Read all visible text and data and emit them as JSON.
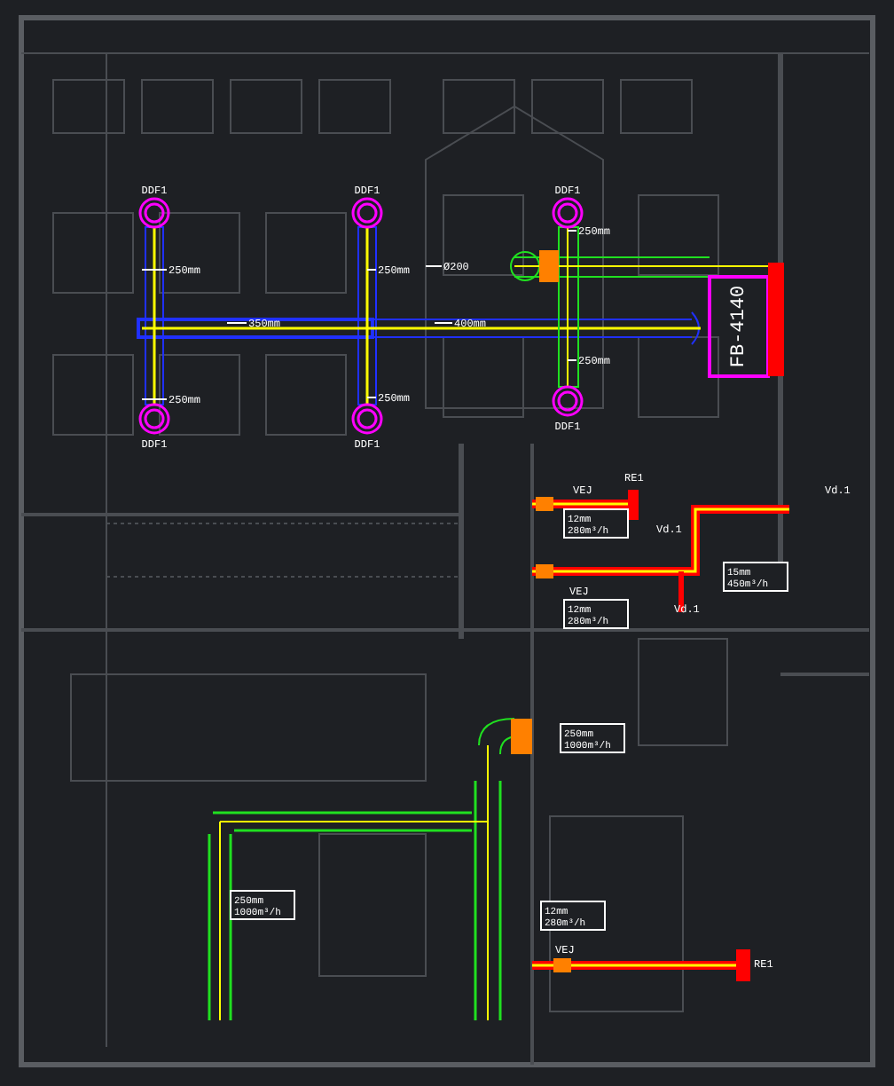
{
  "diffusers": [
    {
      "label": "DDF1"
    },
    {
      "label": "DDF1"
    },
    {
      "label": "DDF1"
    },
    {
      "label": "DDF1"
    },
    {
      "label": "DDF1"
    },
    {
      "label": "DDF1"
    }
  ],
  "duct_sizes": [
    {
      "text": "250mm"
    },
    {
      "text": "250mm"
    },
    {
      "text": "250mm"
    },
    {
      "text": "250mm"
    },
    {
      "text": "250mm"
    },
    {
      "text": "250mm"
    },
    {
      "text": "350mm"
    },
    {
      "text": "400mm"
    },
    {
      "text": "Ø200"
    }
  ],
  "unit": {
    "label": "FB-4140"
  },
  "valve_tags": [
    {
      "text": "VEJ"
    },
    {
      "text": "RE1"
    },
    {
      "text": "Vd.1"
    },
    {
      "text": "Vd.1"
    },
    {
      "text": "VEJ"
    },
    {
      "text": "Vd.1"
    },
    {
      "text": "VEJ"
    },
    {
      "text": "RE1"
    }
  ],
  "flow_notes": [
    {
      "lines": [
        "12mm",
        "280m³/h"
      ]
    },
    {
      "lines": [
        "12mm",
        "280m³/h"
      ]
    },
    {
      "lines": [
        "15mm",
        "450m³/h"
      ]
    },
    {
      "lines": [
        "250mm",
        "1000m³/h"
      ]
    },
    {
      "lines": [
        "250mm",
        "1000m³/h"
      ]
    },
    {
      "lines": [
        "12mm",
        "280m³/h"
      ]
    }
  ]
}
